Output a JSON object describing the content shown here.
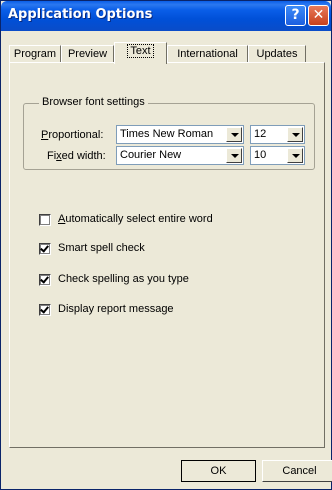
{
  "window": {
    "title": "Application Options",
    "help_glyph": "?",
    "close_glyph": "✕"
  },
  "tabs": [
    {
      "label": "Program",
      "active": false
    },
    {
      "label": "Preview",
      "active": false
    },
    {
      "label": "Text",
      "active": true
    },
    {
      "label": "International",
      "active": false
    },
    {
      "label": "Updates",
      "active": false
    }
  ],
  "font_settings": {
    "legend": "Browser font settings",
    "proportional": {
      "label_accel": "P",
      "label_rest": "roportional:",
      "font": "Times New Roman",
      "size": "12"
    },
    "fixed_width": {
      "label_pre": "Fi",
      "label_accel": "x",
      "label_rest": "ed width:",
      "font": "Courier New",
      "size": "10"
    }
  },
  "options": [
    {
      "accel": "A",
      "rest": "utomatically select entire word",
      "checked": false
    },
    {
      "accel": "",
      "rest": "Smart spell check",
      "checked": true
    },
    {
      "accel": "",
      "rest": "Check spelling as you type",
      "checked": true
    },
    {
      "accel": "",
      "rest": "Display report message",
      "checked": true
    }
  ],
  "buttons": {
    "ok": "OK",
    "cancel": "Cancel"
  },
  "colors": {
    "titlebar": "#0a5ee8",
    "dialog_face": "#ece9d8"
  }
}
